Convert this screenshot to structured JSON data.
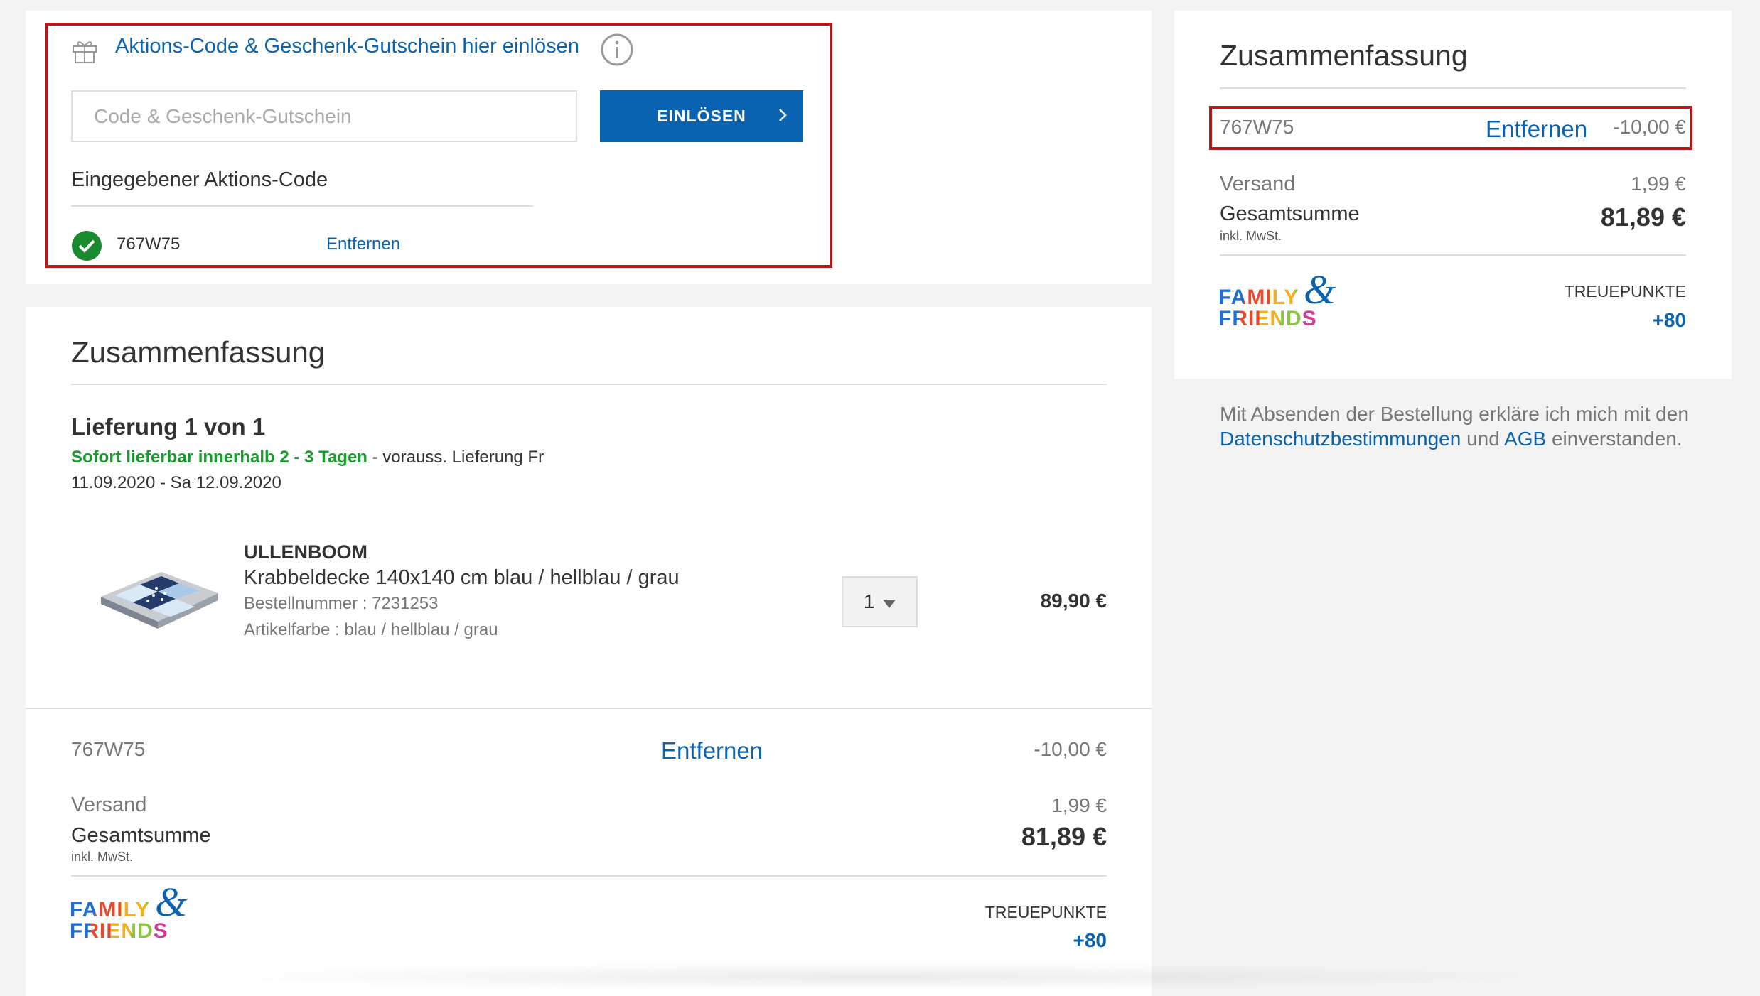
{
  "coupon_box": {
    "title": "Aktions-Code & Geschenk-Gutschein hier einlösen",
    "input_placeholder": "Code & Geschenk-Gutschein",
    "redeem_label": "EINLÖSEN",
    "entered_heading": "Eingegebener Aktions-Code",
    "entered_code": "767W75",
    "remove_label": "Entfernen"
  },
  "main_summary": {
    "title": "Zusammenfassung",
    "delivery_heading": "Lieferung 1 von 1",
    "availability": "Sofort lieferbar innerhalb 2 - 3 Tagen",
    "delivery_estimate_1": " - vorauss. Lieferung Fr",
    "delivery_estimate_2": "11.09.2020 - Sa 12.09.2020",
    "product": {
      "brand": "ULLENBOOM",
      "name": "Krabbeldecke 140x140 cm blau / hellblau / grau",
      "order_number": "Bestellnummer : 7231253",
      "color": "Artikelfarbe : blau / hellblau / grau",
      "quantity": "1",
      "price": "89,90 €"
    },
    "coupon_code": "767W75",
    "coupon_remove": "Entfernen",
    "coupon_value": "-10,00 €",
    "shipping_label": "Versand",
    "shipping_value": "1,99 €",
    "total_label": "Gesamtsumme",
    "vat_note": "inkl. MwSt.",
    "total_value": "81,89 €",
    "loyalty_label": "TREUEPUNKTE",
    "loyalty_value": "+80"
  },
  "side_summary": {
    "title": "Zusammenfassung",
    "coupon_code": "767W75",
    "coupon_remove": "Entfernen",
    "coupon_value": "-10,00 €",
    "shipping_label": "Versand",
    "shipping_value": "1,99 €",
    "total_label": "Gesamtsumme",
    "vat_note": "inkl. MwSt.",
    "total_value": "81,89 €",
    "loyalty_label": "TREUEPUNKTE",
    "loyalty_value": "+80"
  },
  "family_friends_logo": {
    "line1": "FAMILY",
    "line2": "FRIENDS",
    "amp": "&"
  },
  "legal": {
    "text_1": "Mit Absenden der Bestellung erkläre ich mich mit den",
    "privacy_link": "Datenschutzbestimmungen",
    "and": " und ",
    "terms_link": "AGB",
    "text_2": " einverstanden."
  },
  "colors": {
    "accent_blue": "#0a63b0",
    "success_green": "#1a9a2e",
    "highlight_red": "#b31b1b"
  }
}
